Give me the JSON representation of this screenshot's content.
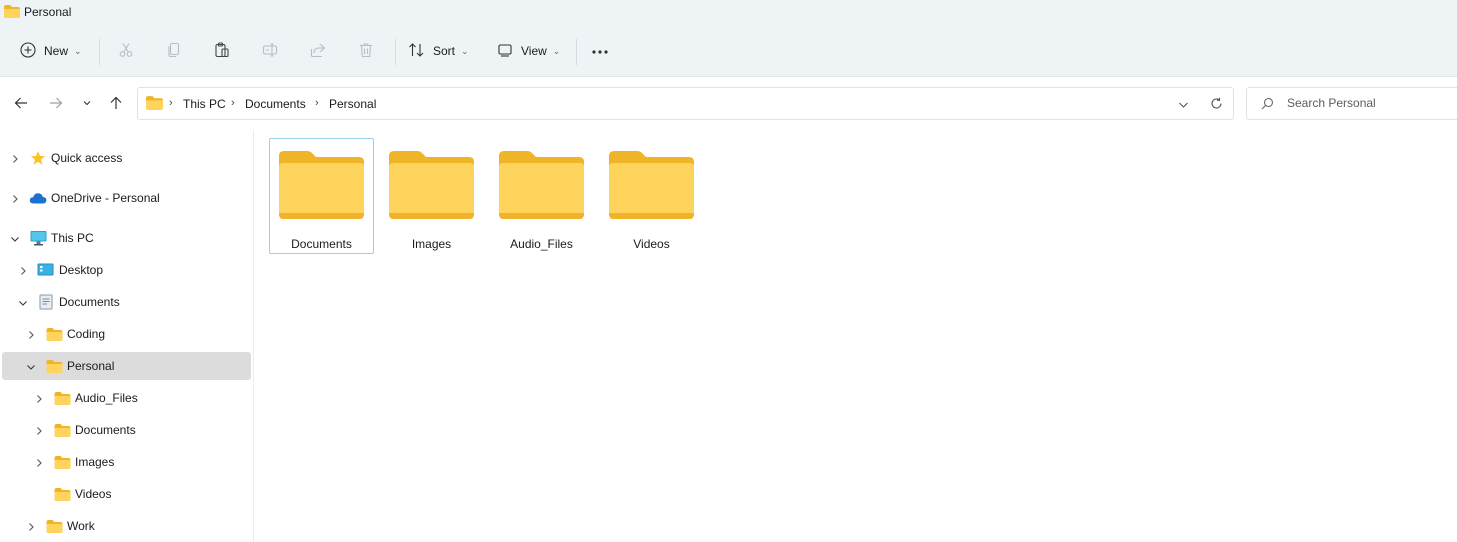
{
  "window": {
    "title": "Personal"
  },
  "toolbar": {
    "new_label": "New",
    "sort_label": "Sort",
    "view_label": "View"
  },
  "address": {
    "crumbs": [
      "This PC",
      "Documents",
      "Personal"
    ]
  },
  "search": {
    "placeholder": "Search Personal"
  },
  "nav": {
    "items": [
      {
        "label": "Quick access"
      },
      {
        "label": "OneDrive - Personal"
      },
      {
        "label": "This PC"
      },
      {
        "label": "Desktop"
      },
      {
        "label": "Documents"
      },
      {
        "label": "Coding"
      },
      {
        "label": "Personal"
      },
      {
        "label": "Audio_Files"
      },
      {
        "label": "Documents"
      },
      {
        "label": "Images"
      },
      {
        "label": "Videos"
      },
      {
        "label": "Work"
      }
    ]
  },
  "content": {
    "folders": [
      {
        "name": "Documents"
      },
      {
        "name": "Images"
      },
      {
        "name": "Audio_Files"
      },
      {
        "name": "Videos"
      }
    ]
  },
  "colors": {
    "folder_back": "#f0b429",
    "folder_front": "#ffd45c",
    "selection": "#dcdcdc",
    "focus_border": "#99d1ec"
  }
}
